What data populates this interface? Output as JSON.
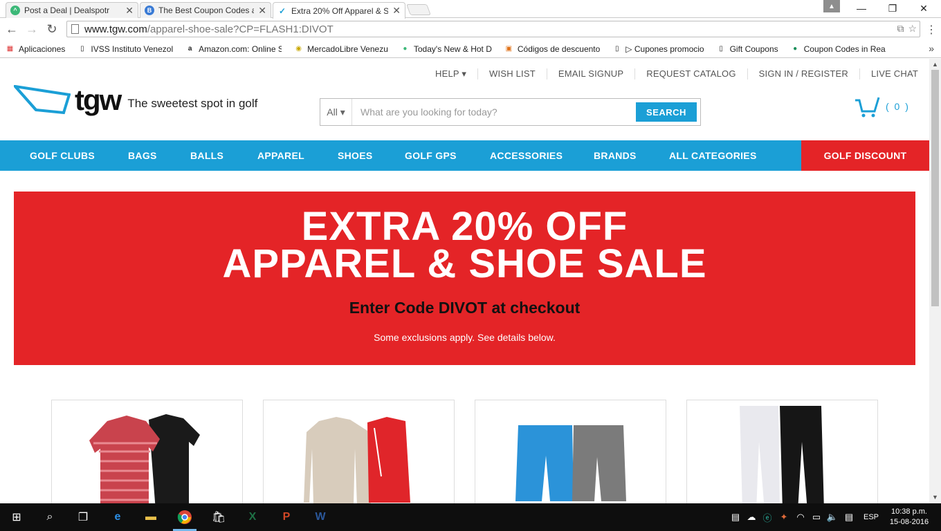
{
  "browser": {
    "tabs": [
      {
        "label": "Post a Deal | Dealspotr",
        "icon_color": "#3cb878"
      },
      {
        "label": "The Best Coupon Codes a",
        "icon_color": "#3a7bd5"
      },
      {
        "label": "Extra 20% Off Apparel & S",
        "icon_color": "#1b9fd6"
      }
    ],
    "address": {
      "host": "www.tgw.com",
      "path": "/apparel-shoe-sale?CP=FLASH1:DIVOT"
    },
    "bookmarks": [
      {
        "label": "Aplicaciones",
        "icon": "apps-grid-icon"
      },
      {
        "label": "IVSS Instituto Venezol",
        "icon": "page-icon"
      },
      {
        "label": "Amazon.com: Online S",
        "icon": "amazon-icon"
      },
      {
        "label": "MercadoLibre Venezu",
        "icon": "mercadolibre-icon"
      },
      {
        "label": "Today's New & Hot D",
        "icon": "dealspotr-icon"
      },
      {
        "label": "Códigos de descuento",
        "icon": "coupon-icon"
      },
      {
        "label": "▷ Cupones promocio",
        "icon": "page-icon"
      },
      {
        "label": "Gift Coupons",
        "icon": "page-icon"
      },
      {
        "label": "Coupon Codes in Rea",
        "icon": "coupon-green-icon"
      }
    ]
  },
  "site": {
    "util_nav": [
      "HELP ▾",
      "WISH LIST",
      "EMAIL SIGNUP",
      "REQUEST CATALOG",
      "SIGN IN / REGISTER",
      "LIVE CHAT"
    ],
    "logo": {
      "wordmark": "tgw",
      "tagline": "The sweetest spot in golf"
    },
    "search": {
      "scope": "All ▾",
      "placeholder": "What are you looking for today?",
      "button": "SEARCH"
    },
    "cart": {
      "count": "( 0 )"
    },
    "main_nav": [
      "GOLF CLUBS",
      "BAGS",
      "BALLS",
      "APPAREL",
      "SHOES",
      "GOLF GPS",
      "ACCESSORIES",
      "BRANDS",
      "ALL CATEGORIES"
    ],
    "discount": "GOLF DISCOUNT",
    "banner": {
      "line1": "EXTRA 20% OFF",
      "line2": "APPAREL & SHOE SALE",
      "code_line": "Enter Code DIVOT at checkout",
      "fine_print": "Some exclusions apply. See details below."
    },
    "tiles": [
      {
        "name": "polos"
      },
      {
        "name": "outerwear"
      },
      {
        "name": "shorts"
      },
      {
        "name": "pants"
      }
    ]
  },
  "taskbar": {
    "language": "ESP",
    "time": "10:38 p.m.",
    "date": "15-08-2016"
  },
  "colors": {
    "brand_blue": "#1b9fd6",
    "brand_red": "#e42427"
  }
}
